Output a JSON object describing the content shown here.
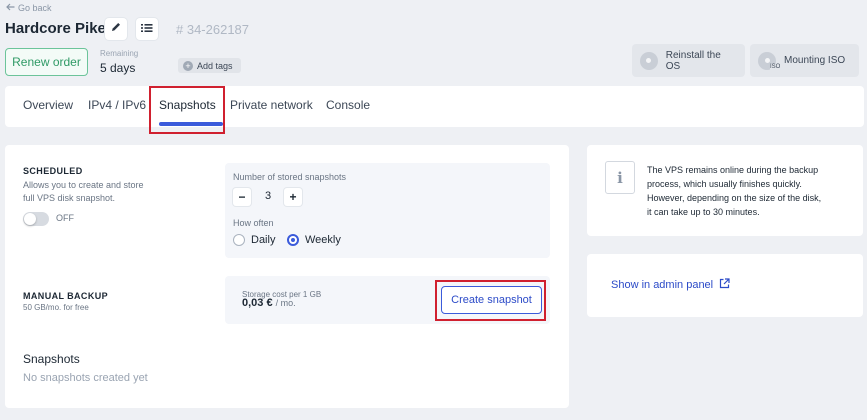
{
  "header": {
    "back_label": "Go back",
    "title": "Hardcore Pike",
    "order_id": "# 34-262187",
    "renew_label": "Renew order",
    "remaining_label": "Remaining",
    "remaining_value": "5 days",
    "add_tags_label": "Add tags",
    "reinstall_label": "Reinstall the OS",
    "mount_label": "Mounting ISO",
    "mount_badge": "ISO"
  },
  "tabs": [
    {
      "label": "Overview"
    },
    {
      "label": "IPv4 / IPv6"
    },
    {
      "label": "Snapshots"
    },
    {
      "label": "Private network"
    },
    {
      "label": "Console"
    }
  ],
  "active_tab": "Snapshots",
  "scheduled": {
    "title": "SCHEDULED",
    "description": "Allows you to create and store full VPS disk snapshot.",
    "toggle_state": "OFF",
    "stored_label": "Number of stored snapshots",
    "stored_value": "3",
    "minus_label": "−",
    "plus_label": "+",
    "how_often_label": "How often",
    "options": [
      {
        "label": "Daily",
        "checked": false
      },
      {
        "label": "Weekly",
        "checked": true
      }
    ]
  },
  "manual": {
    "title": "MANUAL BACKUP",
    "subtitle": "50 GB/mo. for free",
    "cost_label": "Storage cost per 1 GB",
    "cost_value": "0,03 €",
    "cost_unit": "/ mo.",
    "create_label": "Create snapshot"
  },
  "snapshots": {
    "title": "Snapshots",
    "empty_text": "No snapshots created yet"
  },
  "info": {
    "icon_glyph": "i",
    "text": "The VPS remains online during the backup process, which usually finishes quickly. However, depending on the size of the disk, it can take up to 30 minutes."
  },
  "admin_link": {
    "label": "Show in admin panel"
  },
  "colors": {
    "accent": "#3b5bdb",
    "renew_green": "#2f9a66",
    "highlight_red": "#d0202f",
    "background": "#eef0f4"
  }
}
